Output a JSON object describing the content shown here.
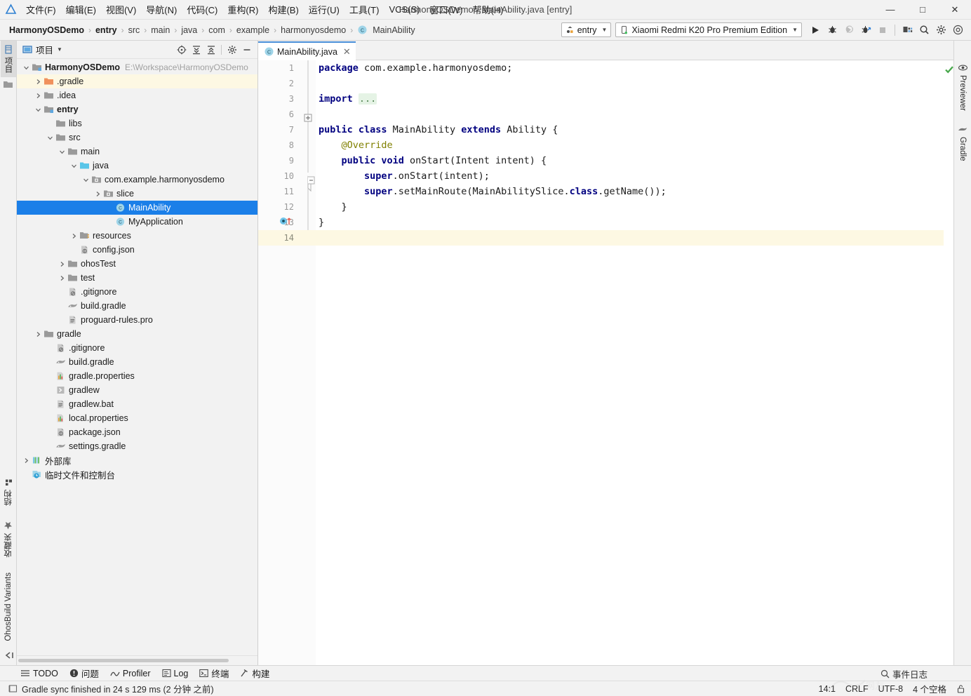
{
  "window": {
    "title": "HarmonyOSDemo - MainAbility.java [entry]",
    "minimize": "—",
    "maximize": "□",
    "close": "✕"
  },
  "menubar": {
    "items": [
      {
        "label": "文件(F)"
      },
      {
        "label": "编辑(E)"
      },
      {
        "label": "视图(V)"
      },
      {
        "label": "导航(N)"
      },
      {
        "label": "代码(C)"
      },
      {
        "label": "重构(R)"
      },
      {
        "label": "构建(B)"
      },
      {
        "label": "运行(U)"
      },
      {
        "label": "工具(T)"
      },
      {
        "label": "VCS(S)"
      },
      {
        "label": "窗口(W)"
      },
      {
        "label": "帮助(H)"
      }
    ]
  },
  "breadcrumb": {
    "items": [
      "HarmonyOSDemo",
      "entry",
      "src",
      "main",
      "java",
      "com",
      "example",
      "harmonyosdemo",
      "MainAbility"
    ],
    "separator": "›",
    "last_icon": "class-icon"
  },
  "toolbar": {
    "run_config": "entry",
    "device": "Xiaomi Redmi K20 Pro Premium Edition",
    "buttons": [
      {
        "name": "run-button",
        "glyph": "▶"
      },
      {
        "name": "debug-button",
        "glyph": "debug"
      },
      {
        "name": "attach-debugger-button",
        "glyph": "attach"
      },
      {
        "name": "profile-button",
        "glyph": "profile"
      },
      {
        "name": "stop-button",
        "glyph": "■"
      },
      {
        "name": "device-manager-button",
        "glyph": "devices"
      },
      {
        "name": "search-everywhere-button",
        "glyph": "search"
      },
      {
        "name": "settings-button",
        "glyph": "gear"
      },
      {
        "name": "account-button",
        "glyph": "account"
      }
    ]
  },
  "project_panel": {
    "title": "项目",
    "tools": [
      {
        "name": "select-opened-file-icon"
      },
      {
        "name": "expand-all-icon"
      },
      {
        "name": "collapse-all-icon"
      },
      {
        "name": "settings-icon"
      },
      {
        "name": "hide-icon"
      }
    ],
    "tree": [
      {
        "label": "HarmonyOSDemo",
        "path": "E:\\Workspace\\HarmonyOSDemo",
        "indent": 0,
        "arrow": "down",
        "icon": "module-folder",
        "bold": true,
        "state": "normal"
      },
      {
        "label": ".gradle",
        "indent": 1,
        "arrow": "right",
        "icon": "folder-orange",
        "state": "highlight"
      },
      {
        "label": ".idea",
        "indent": 1,
        "arrow": "right",
        "icon": "folder-gray",
        "state": "normal"
      },
      {
        "label": "entry",
        "indent": 1,
        "arrow": "down",
        "icon": "module-folder",
        "bold": true,
        "state": "normal"
      },
      {
        "label": "libs",
        "indent": 2,
        "arrow": "none",
        "icon": "folder-gray",
        "state": "normal"
      },
      {
        "label": "src",
        "indent": 2,
        "arrow": "down",
        "icon": "folder-gray",
        "state": "normal"
      },
      {
        "label": "main",
        "indent": 3,
        "arrow": "down",
        "icon": "folder-gray",
        "state": "normal"
      },
      {
        "label": "java",
        "indent": 4,
        "arrow": "down",
        "icon": "folder-source",
        "state": "normal"
      },
      {
        "label": "com.example.harmonyosdemo",
        "indent": 5,
        "arrow": "down",
        "icon": "package",
        "state": "normal"
      },
      {
        "label": "slice",
        "indent": 6,
        "arrow": "right",
        "icon": "package",
        "state": "normal"
      },
      {
        "label": "MainAbility",
        "indent": 7,
        "arrow": "none",
        "icon": "java-class",
        "state": "selected"
      },
      {
        "label": "MyApplication",
        "indent": 7,
        "arrow": "none",
        "icon": "java-class",
        "state": "normal"
      },
      {
        "label": "resources",
        "indent": 4,
        "arrow": "right",
        "icon": "resource-folder",
        "state": "normal"
      },
      {
        "label": "config.json",
        "indent": 4,
        "arrow": "none",
        "icon": "json-file",
        "state": "normal"
      },
      {
        "label": "ohosTest",
        "indent": 3,
        "arrow": "right",
        "icon": "folder-gray",
        "state": "normal"
      },
      {
        "label": "test",
        "indent": 3,
        "arrow": "right",
        "icon": "folder-gray",
        "state": "normal"
      },
      {
        "label": ".gitignore",
        "indent": 3,
        "arrow": "none",
        "icon": "gitignore-file",
        "state": "normal"
      },
      {
        "label": "build.gradle",
        "indent": 3,
        "arrow": "none",
        "icon": "gradle-file",
        "state": "normal"
      },
      {
        "label": "proguard-rules.pro",
        "indent": 3,
        "arrow": "none",
        "icon": "text-file",
        "state": "normal"
      },
      {
        "label": "gradle",
        "indent": 1,
        "arrow": "right",
        "icon": "folder-gray",
        "state": "normal"
      },
      {
        "label": ".gitignore",
        "indent": 2,
        "arrow": "none",
        "icon": "gitignore-file",
        "state": "normal"
      },
      {
        "label": "build.gradle",
        "indent": 2,
        "arrow": "none",
        "icon": "gradle-file",
        "state": "normal"
      },
      {
        "label": "gradle.properties",
        "indent": 2,
        "arrow": "none",
        "icon": "properties-file",
        "state": "normal"
      },
      {
        "label": "gradlew",
        "indent": 2,
        "arrow": "none",
        "icon": "script-file",
        "state": "normal"
      },
      {
        "label": "gradlew.bat",
        "indent": 2,
        "arrow": "none",
        "icon": "text-file",
        "state": "normal"
      },
      {
        "label": "local.properties",
        "indent": 2,
        "arrow": "none",
        "icon": "properties-file",
        "state": "normal"
      },
      {
        "label": "package.json",
        "indent": 2,
        "arrow": "none",
        "icon": "json-file",
        "state": "normal"
      },
      {
        "label": "settings.gradle",
        "indent": 2,
        "arrow": "none",
        "icon": "gradle-file",
        "state": "normal"
      },
      {
        "label": "外部库",
        "indent": 0,
        "arrow": "right",
        "icon": "external-libraries",
        "state": "normal"
      },
      {
        "label": "临时文件和控制台",
        "indent": 0,
        "arrow": "none",
        "icon": "scratches",
        "state": "normal"
      }
    ]
  },
  "left_strip": {
    "top": [
      {
        "label": "项目",
        "name": "tool-tab-project",
        "selected": true
      }
    ],
    "bottom": [
      {
        "label": "结构",
        "name": "tool-tab-structure"
      },
      {
        "label": "收藏夹",
        "name": "tool-tab-favorites"
      },
      {
        "label": "OhosBuild Variants",
        "name": "tool-tab-ohosbuild-variants"
      }
    ]
  },
  "right_strip": {
    "items": [
      {
        "label": "Previewer",
        "name": "tool-tab-previewer"
      },
      {
        "label": "Gradle",
        "name": "tool-tab-gradle"
      }
    ]
  },
  "editor": {
    "tab": {
      "label": "MainAbility.java",
      "close": "✕",
      "icon": "java-class-icon"
    },
    "status_icon": "no-errors-check",
    "gutter_numbers": [
      "1",
      "2",
      "3",
      "6",
      "7",
      "8",
      "9",
      "10",
      "11",
      "12",
      "13",
      "14"
    ],
    "highlight_line_index": 11,
    "lines": [
      {
        "n": "1",
        "segments": [
          {
            "t": "package",
            "c": "kw"
          },
          {
            "t": " com.example.harmonyosdemo;",
            "c": ""
          }
        ]
      },
      {
        "n": "2",
        "segments": []
      },
      {
        "n": "3",
        "segments": [
          {
            "t": "import",
            "c": "kw"
          },
          {
            "t": " ",
            "c": ""
          },
          {
            "t": "...",
            "c": "fold"
          }
        ]
      },
      {
        "n": "6",
        "segments": []
      },
      {
        "n": "7",
        "segments": [
          {
            "t": "public class",
            "c": "kw"
          },
          {
            "t": " MainAbility ",
            "c": ""
          },
          {
            "t": "extends",
            "c": "kw"
          },
          {
            "t": " Ability {",
            "c": ""
          }
        ]
      },
      {
        "n": "8",
        "segments": [
          {
            "t": "    @Override",
            "c": "anno"
          }
        ]
      },
      {
        "n": "9",
        "segments": [
          {
            "t": "    ",
            "c": ""
          },
          {
            "t": "public void",
            "c": "kw"
          },
          {
            "t": " onStart(Intent intent) {",
            "c": ""
          }
        ]
      },
      {
        "n": "10",
        "segments": [
          {
            "t": "        ",
            "c": ""
          },
          {
            "t": "super",
            "c": "kw"
          },
          {
            "t": ".onStart(intent);",
            "c": ""
          }
        ]
      },
      {
        "n": "11",
        "segments": [
          {
            "t": "        ",
            "c": ""
          },
          {
            "t": "super",
            "c": "kw"
          },
          {
            "t": ".setMainRoute(MainAbilitySlice.",
            "c": ""
          },
          {
            "t": "class",
            "c": "kw"
          },
          {
            "t": ".getName());",
            "c": ""
          }
        ]
      },
      {
        "n": "12",
        "segments": [
          {
            "t": "    }",
            "c": ""
          }
        ]
      },
      {
        "n": "13",
        "segments": [
          {
            "t": "}",
            "c": ""
          }
        ]
      },
      {
        "n": "14",
        "segments": []
      }
    ]
  },
  "tool_windows": [
    {
      "label": "TODO",
      "name": "tool-window-todo",
      "icon": "todo-icon"
    },
    {
      "label": "问题",
      "name": "tool-window-problems",
      "icon": "problems-icon"
    },
    {
      "label": "Profiler",
      "name": "tool-window-profiler",
      "icon": "profiler-icon"
    },
    {
      "label": "Log",
      "name": "tool-window-log",
      "icon": "log-icon"
    },
    {
      "label": "终端",
      "name": "tool-window-terminal",
      "icon": "terminal-icon"
    },
    {
      "label": "构建",
      "name": "tool-window-build",
      "icon": "build-icon"
    }
  ],
  "status_bar": {
    "message": "Gradle sync finished in 24 s 129 ms (2 分钟 之前)",
    "event_log": "事件日志",
    "caret": "14:1",
    "line_separator": "CRLF",
    "encoding": "UTF-8",
    "indent": "4 个空格",
    "lock_icon": "read-write-icon"
  },
  "colors": {
    "accent": "#1b7fe8",
    "keyword": "#000080",
    "annotation": "#808000",
    "highlight_row": "#fdf8e3",
    "ok": "#49a84c"
  }
}
